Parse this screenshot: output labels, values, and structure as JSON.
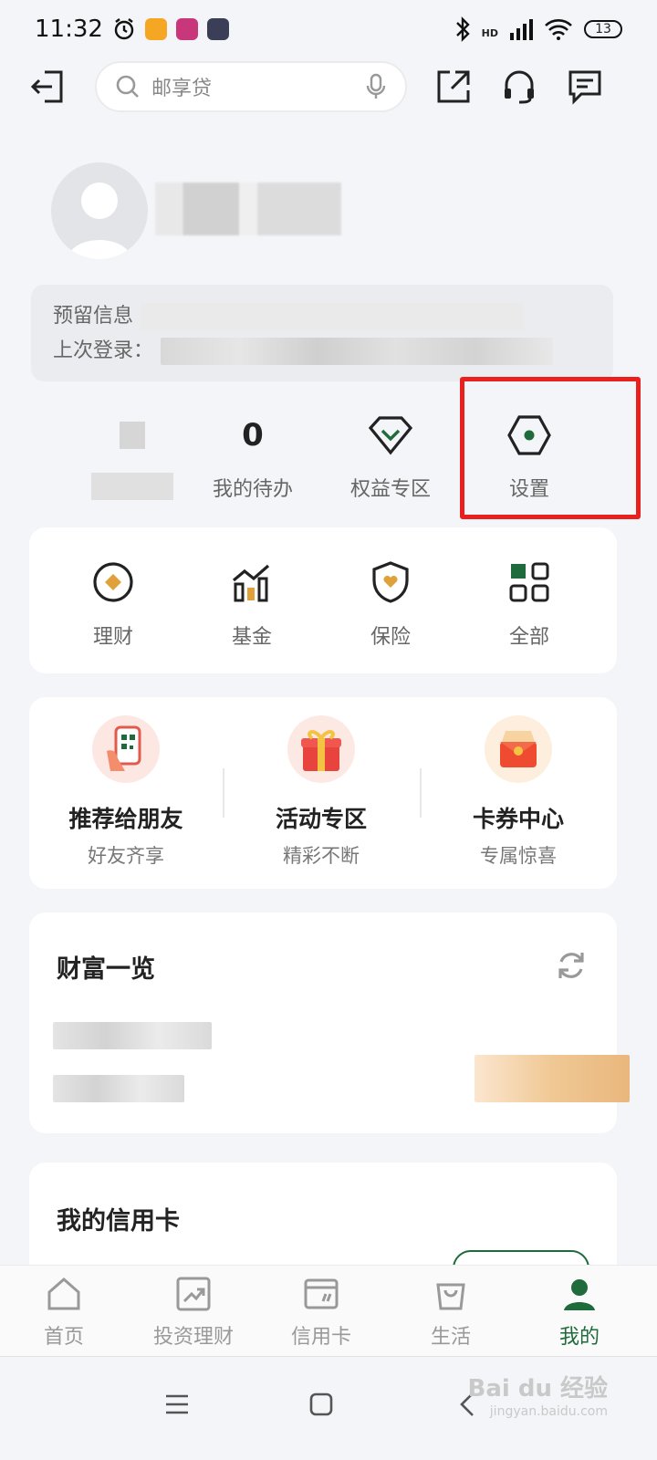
{
  "status_bar": {
    "time": "11:32",
    "network": "HD",
    "battery": "13"
  },
  "top_nav": {
    "search_placeholder": "邮享贷"
  },
  "profile": {
    "info_line_1": "预留信息",
    "info_line_2": "上次登录："
  },
  "quick_row": {
    "todo_count": "0",
    "todo_label": "我的待办",
    "rights_label": "权益专区",
    "settings_label": "设置"
  },
  "services": [
    {
      "label": "理财",
      "icon": "wealth-icon"
    },
    {
      "label": "基金",
      "icon": "fund-icon"
    },
    {
      "label": "保险",
      "icon": "insurance-icon"
    },
    {
      "label": "全部",
      "icon": "all-apps-icon"
    }
  ],
  "promos": [
    {
      "title": "推荐给朋友",
      "subtitle": "好友齐享",
      "icon": "recommend-icon"
    },
    {
      "title": "活动专区",
      "subtitle": "精彩不断",
      "icon": "gift-icon"
    },
    {
      "title": "卡券中心",
      "subtitle": "专属惊喜",
      "icon": "coupon-icon"
    }
  ],
  "wealth": {
    "title": "财富一览"
  },
  "credit": {
    "title": "我的信用卡"
  },
  "tabs": [
    {
      "label": "首页",
      "active": false
    },
    {
      "label": "投资理财",
      "active": false
    },
    {
      "label": "信用卡",
      "active": false
    },
    {
      "label": "生活",
      "active": false
    },
    {
      "label": "我的",
      "active": true
    }
  ],
  "colors": {
    "brand_green": "#1f6b3b",
    "highlight_red": "#e8201e"
  },
  "watermark": {
    "text": "Bai du 经验",
    "sub": "jingyan.baidu.com"
  }
}
